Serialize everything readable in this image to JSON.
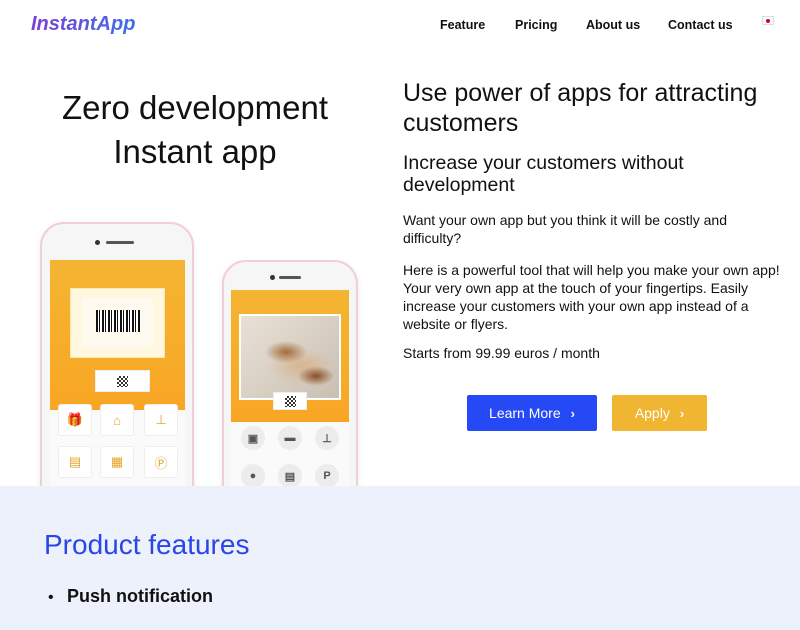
{
  "header": {
    "logo": "InstantApp",
    "nav": [
      "Feature",
      "Pricing",
      "About us",
      "Contact us"
    ]
  },
  "hero": {
    "title_line1": "Zero development",
    "title_line2": "Instant app",
    "heading": "Use power of apps for attracting customers",
    "subheading": "Increase your customers without development",
    "para1": "Want your own app but you think it will be costly and difficulty?",
    "para2": "Here is a powerful tool that will help you make your own app! Your very own app at the touch of your fingertips. Easily increase your customers with your own app instead of a website or flyers.",
    "price": "Starts from 99.99 euros / month",
    "learn_more": "Learn More",
    "apply": "Apply"
  },
  "features": {
    "title": "Product features",
    "items": [
      "Push notification"
    ]
  },
  "colors": {
    "primary": "#2549f5",
    "apply": "#f0b531",
    "features_bg": "#edf1fb",
    "features_title": "#2a46e8"
  }
}
